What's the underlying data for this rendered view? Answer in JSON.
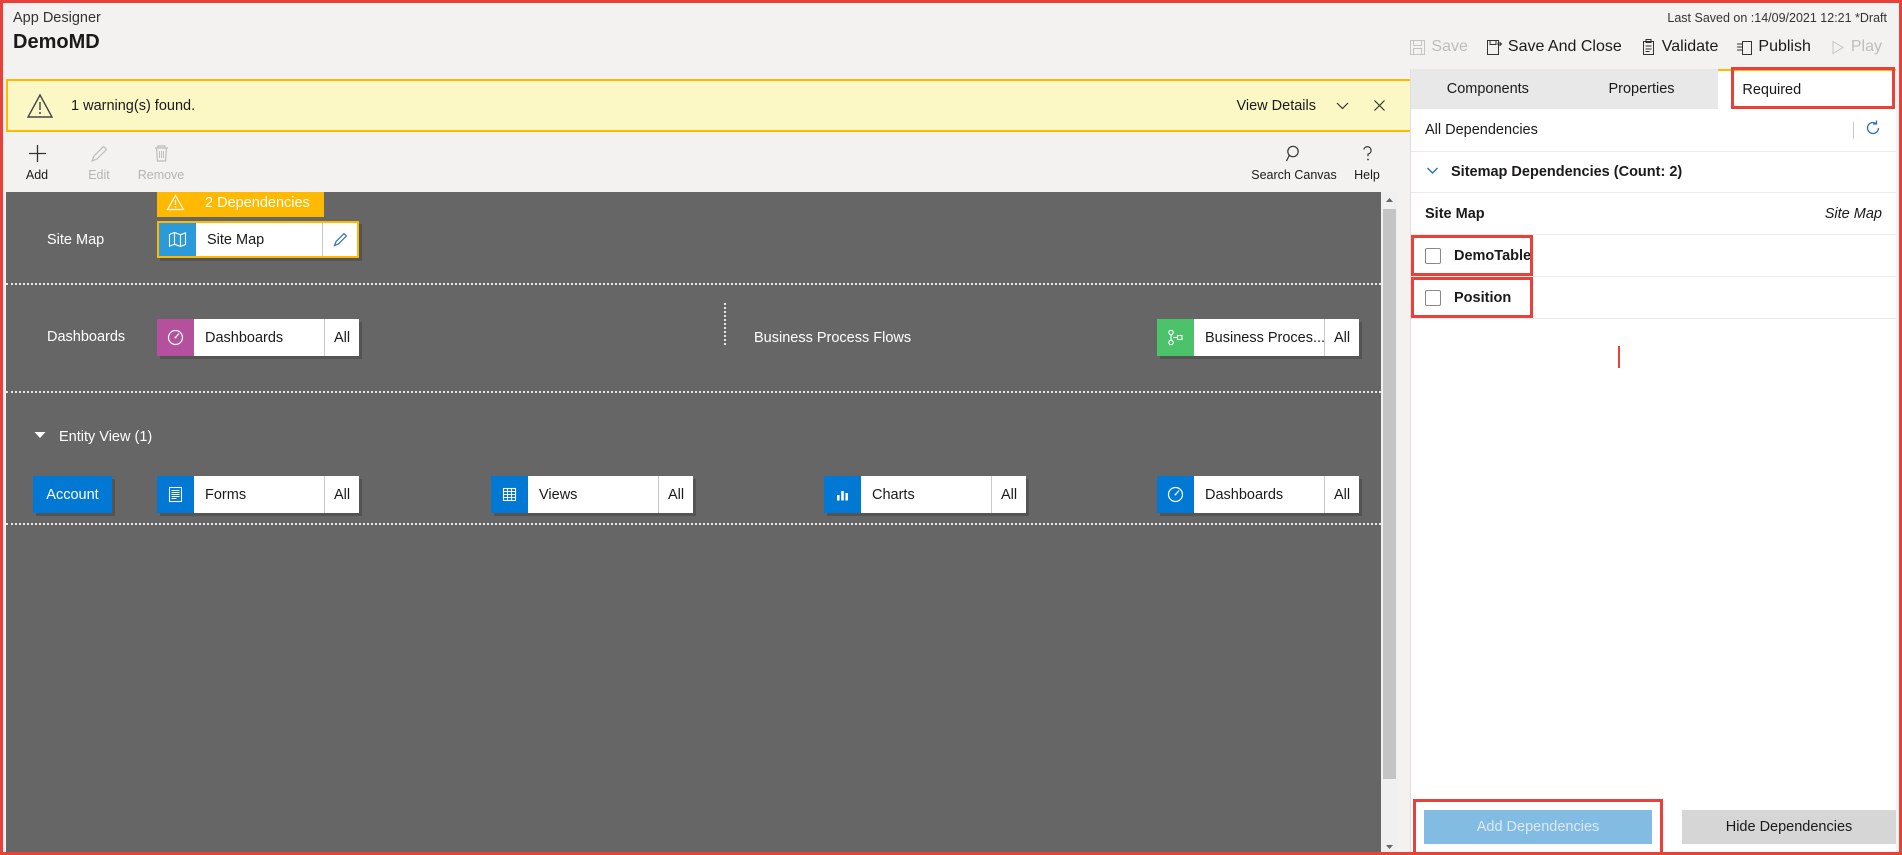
{
  "header": {
    "app_designer_label": "App Designer",
    "app_title": "DemoMD",
    "last_saved": "Last Saved on :14/09/2021 12:21 *Draft",
    "actions": [
      {
        "label": "Save",
        "icon": "save-icon",
        "disabled": true
      },
      {
        "label": "Save And Close",
        "icon": "save-and-close-icon",
        "disabled": false
      },
      {
        "label": "Validate",
        "icon": "validate-icon",
        "disabled": false
      },
      {
        "label": "Publish",
        "icon": "publish-icon",
        "disabled": false
      },
      {
        "label": "Play",
        "icon": "play-icon",
        "disabled": true
      }
    ]
  },
  "warning_bar": {
    "icon": "warning-triangle-icon",
    "message": "1 warning(s) found.",
    "view_details_label": "View Details",
    "chevron_icon": "chevron-down-icon",
    "close_icon": "close-icon",
    "background": "#fbf8c5",
    "border": "#ffb900"
  },
  "command_bar": {
    "items": [
      {
        "label": "Add",
        "icon": "plus-icon",
        "disabled": false
      },
      {
        "label": "Edit",
        "icon": "pencil-icon",
        "disabled": true
      },
      {
        "label": "Remove",
        "icon": "trash-icon",
        "disabled": true
      }
    ],
    "right_items": [
      {
        "label": "Search Canvas",
        "icon": "search-icon",
        "disabled": false
      },
      {
        "label": "Help",
        "icon": "question-icon",
        "disabled": false
      }
    ]
  },
  "canvas": {
    "background": "#666666",
    "rows": [
      {
        "label": "Site Map",
        "badge": {
          "text": "2 Dependencies",
          "icon": "warning-triangle-icon",
          "color": "#ffb900"
        },
        "tile": {
          "name": "Site Map",
          "icon": "sitemap-icon",
          "icon_color": "#2b9ad9",
          "edit_icon": "pencil-icon"
        }
      },
      {
        "label": "Dashboards",
        "tile": {
          "name": "Dashboards",
          "sub": "All",
          "icon": "dashboard-icon",
          "icon_color": "#b4509e"
        },
        "label2": "Business Process Flows",
        "tile2": {
          "name": "Business Proces...",
          "sub": "All",
          "icon": "process-flow-icon",
          "icon_color": "#4cc26a"
        }
      }
    ],
    "entity_view": {
      "title": "Entity View (1)",
      "chevron_icon": "chevron-down-filled-icon",
      "entity_name": "Account",
      "tiles": [
        {
          "name": "Forms",
          "sub": "All",
          "icon": "form-icon",
          "icon_color": "#0078d4"
        },
        {
          "name": "Views",
          "sub": "All",
          "icon": "grid-icon",
          "icon_color": "#0078d4"
        },
        {
          "name": "Charts",
          "sub": "All",
          "icon": "bar-chart-icon",
          "icon_color": "#0078d4"
        },
        {
          "name": "Dashboards",
          "sub": "All",
          "icon": "dashboard-icon",
          "icon_color": "#0078d4"
        }
      ]
    }
  },
  "right_panel": {
    "tabs": [
      {
        "label": "Components",
        "active": false
      },
      {
        "label": "Properties",
        "active": false
      },
      {
        "label": "Required",
        "active": true,
        "highlighted": true
      }
    ],
    "all_dependencies_label": "All Dependencies",
    "refresh_icon": "refresh-icon",
    "sitemap_dependencies_label": "Sitemap Dependencies (Count: 2)",
    "sitemap_chevron_icon": "chevron-down-icon",
    "dependency_group": {
      "name": "Site Map",
      "type": "Site Map",
      "items": [
        {
          "label": "DemoTable",
          "checked": false,
          "highlighted": true
        },
        {
          "label": "Position",
          "checked": false,
          "highlighted": true
        }
      ]
    },
    "footer": {
      "add_label": "Add Dependencies",
      "add_disabled": true,
      "add_highlighted": true,
      "hide_label": "Hide Dependencies"
    }
  },
  "colors": {
    "accent": "#0078d4",
    "warning": "#ffb900",
    "highlight": "#e8413a",
    "canvas": "#666666",
    "dashboard_purple": "#b4509e",
    "process_green": "#4cc26a",
    "sitemap_blue": "#2b9ad9"
  }
}
